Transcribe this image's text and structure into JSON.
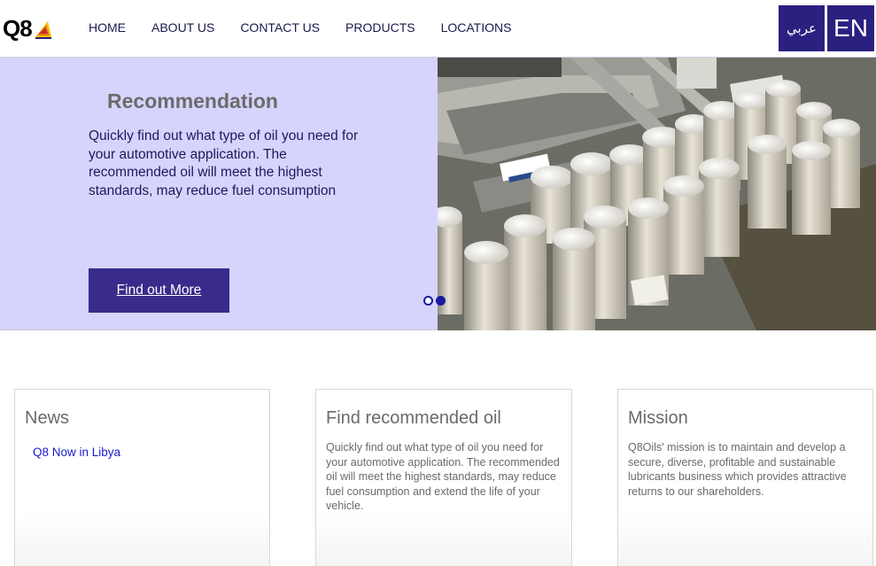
{
  "header": {
    "logo_text": "Q8",
    "nav": [
      {
        "label": "HOME"
      },
      {
        "label": "ABOUT US"
      },
      {
        "label": "CONTACT US"
      },
      {
        "label": "PRODUCTS"
      },
      {
        "label": "LOCATIONS"
      }
    ],
    "lang_ar": "عربي",
    "lang_en": "EN"
  },
  "hero": {
    "title": "Recommendation",
    "text": "Quickly find out what type of oil you need for your automotive application. The recommended oil will meet the highest standards, may reduce fuel consumption",
    "button": "Find out More",
    "slides": 2,
    "active_slide": 2
  },
  "cards": {
    "news": {
      "title": "News",
      "items": [
        "Q8 Now in Libya"
      ]
    },
    "oil": {
      "title": "Find recommended oil",
      "body": "Quickly find out what type of oil you need for your automotive application. The recommended oil will meet the highest standards, may reduce fuel consumption and extend the life of your vehicle."
    },
    "mission": {
      "title": "Mission",
      "body": "Q8Oils' mission is to maintain and develop a secure, diverse, profitable and sustainable lubricants business which provides attractive returns to our shareholders."
    }
  },
  "colors": {
    "brand_blue": "#2a2080",
    "hero_bg": "#d6d4fc",
    "button_bg": "#392b8a",
    "link": "#1a1ad0"
  }
}
